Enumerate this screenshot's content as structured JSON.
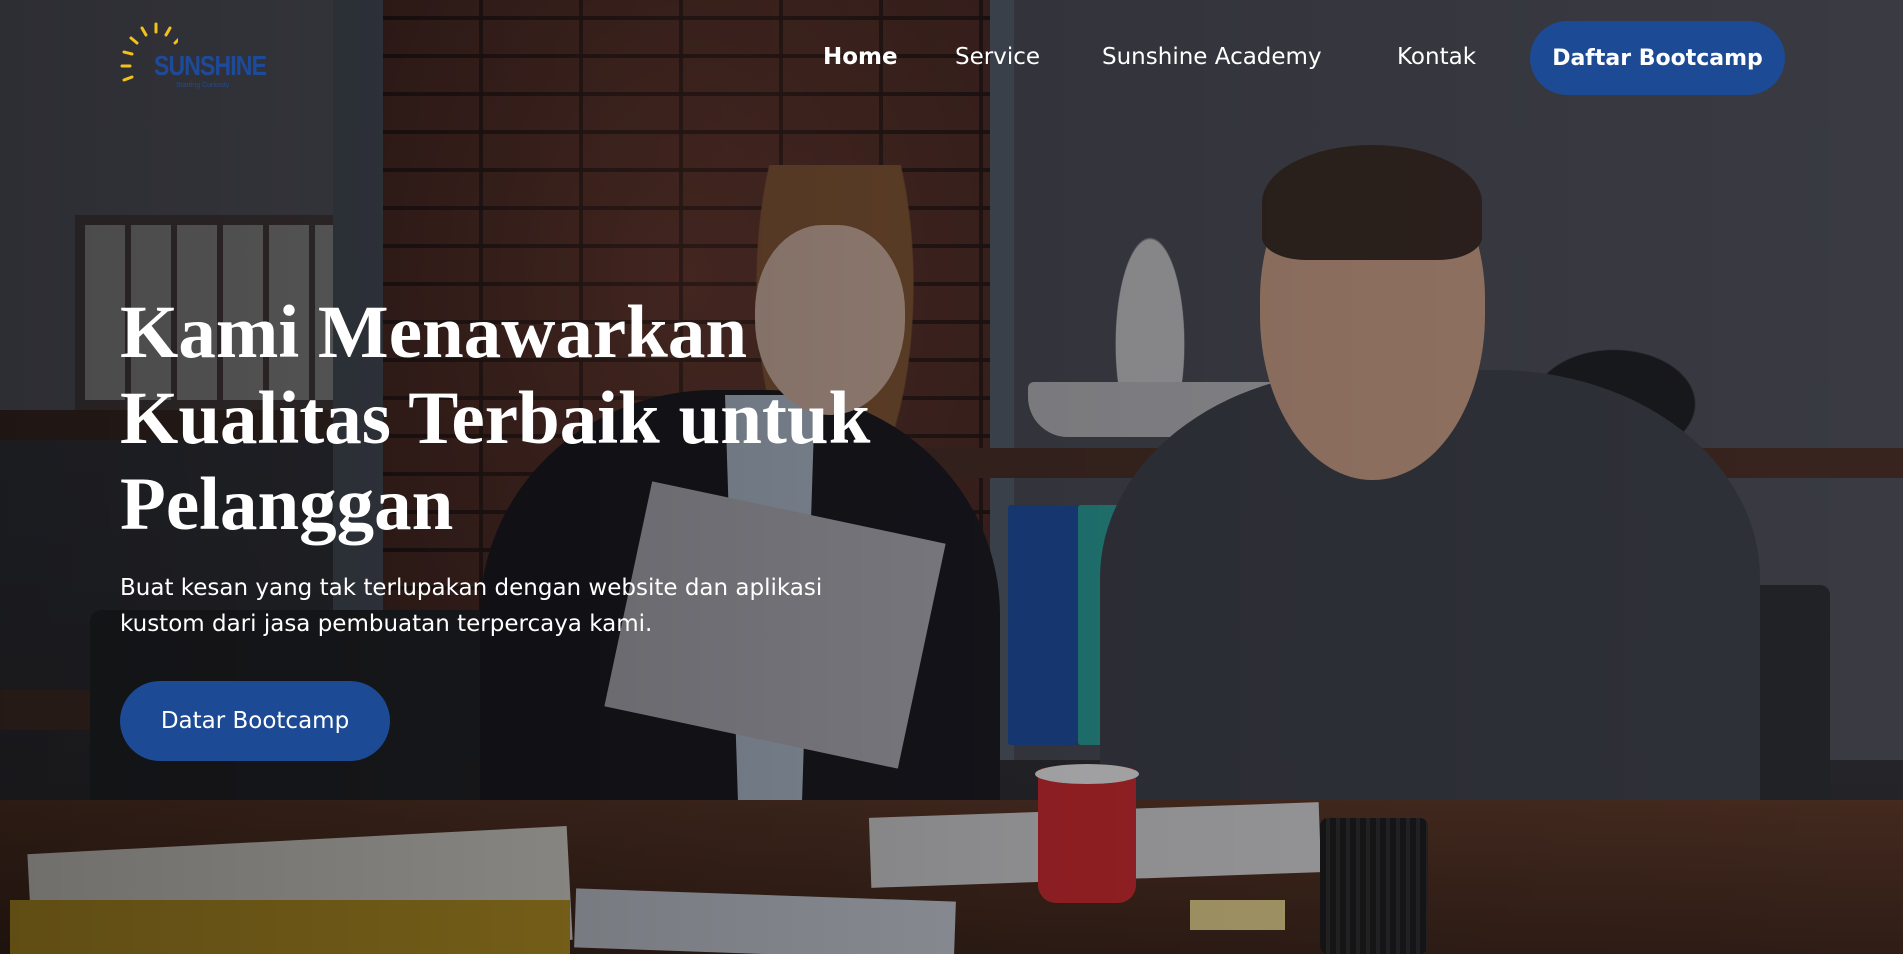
{
  "logo": {
    "text": "SUNSHINE",
    "subtitle": "Starting Curiosity"
  },
  "nav": {
    "items": [
      {
        "label": "Home",
        "active": true
      },
      {
        "label": "Service",
        "active": false
      },
      {
        "label": "Sunshine Academy",
        "active": false
      },
      {
        "label": "Kontak",
        "active": false
      }
    ],
    "cta_label": "Daftar Bootcamp"
  },
  "hero": {
    "title": "Kami Menawarkan Kualitas Terbaik untuk Pelanggan",
    "description": "Buat kesan yang tak terlupakan dengan website dan aplikasi kustom dari jasa pembuatan terpercaya kami.",
    "cta_label": "Datar Bootcamp"
  },
  "colors": {
    "accent": "#1d4a94",
    "logo_sun": "#f2c21b",
    "logo_text": "#1e4a9a",
    "text": "#ffffff"
  },
  "icons": {
    "logo": "sun-icon"
  }
}
